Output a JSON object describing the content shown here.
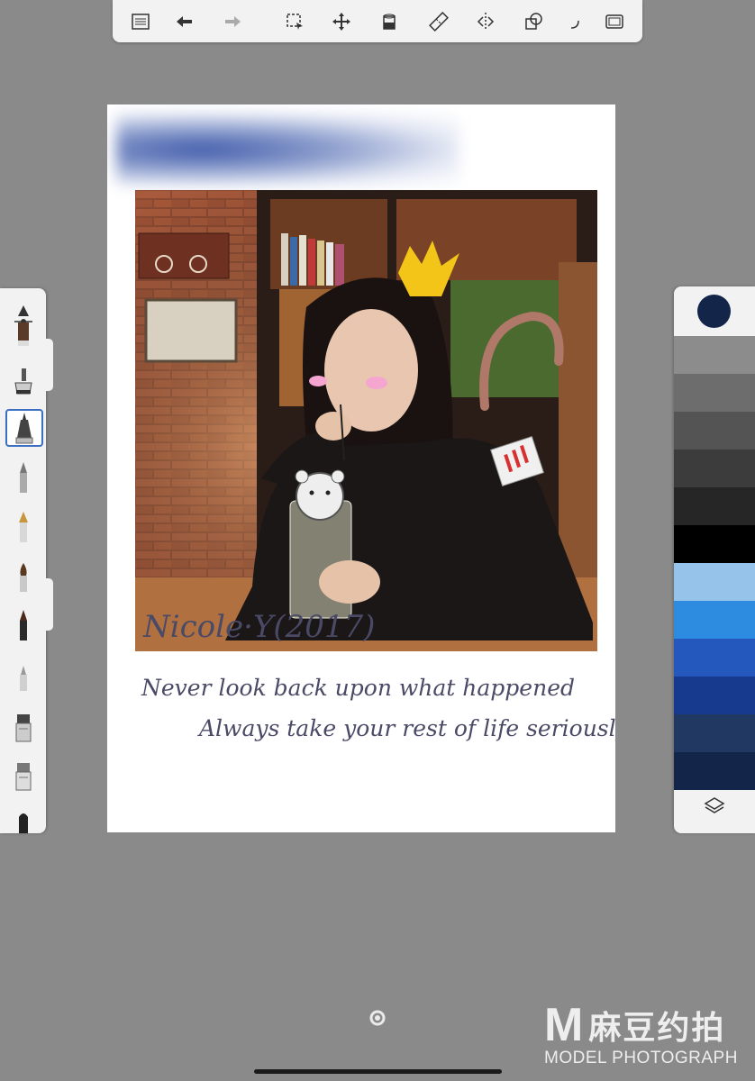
{
  "toolbar": {
    "buttons": [
      {
        "name": "menu-button",
        "icon": "list-icon"
      },
      {
        "name": "undo-button",
        "icon": "undo-arrow-icon"
      },
      {
        "name": "redo-button",
        "icon": "redo-arrow-icon"
      },
      {
        "name": "selection-button",
        "icon": "selection-icon"
      },
      {
        "name": "transform-button",
        "icon": "move-arrows-icon"
      },
      {
        "name": "fill-button",
        "icon": "paint-bucket-icon"
      },
      {
        "name": "ruler-button",
        "icon": "ruler-icon"
      },
      {
        "name": "symmetry-button",
        "icon": "symmetry-icon"
      },
      {
        "name": "shapes-button",
        "icon": "shapes-icon"
      },
      {
        "name": "curve-button",
        "icon": "curve-icon"
      },
      {
        "name": "fullscreen-button",
        "icon": "fullscreen-icon"
      }
    ]
  },
  "brushes": [
    {
      "name": "brush-size-slider",
      "icon": "triangle-slider-icon"
    },
    {
      "name": "brush-marker-top",
      "icon": "marker-icon"
    },
    {
      "name": "brush-inkpot",
      "icon": "ink-pot-icon"
    },
    {
      "name": "brush-fineliner",
      "icon": "fineliner-icon",
      "selected": true
    },
    {
      "name": "brush-pencil",
      "icon": "pencil-icon"
    },
    {
      "name": "brush-fountain-pen",
      "icon": "fountain-pen-icon"
    },
    {
      "name": "brush-paintbrush",
      "icon": "paintbrush-icon"
    },
    {
      "name": "brush-round",
      "icon": "round-brush-icon"
    },
    {
      "name": "brush-airbrush",
      "icon": "airbrush-icon"
    },
    {
      "name": "brush-marker-a",
      "icon": "marker-icon"
    },
    {
      "name": "brush-marker-b",
      "icon": "marker-icon"
    },
    {
      "name": "brush-chisel",
      "icon": "chisel-icon"
    }
  ],
  "colors": {
    "current": "#14254a",
    "swatches": [
      "#8c8c8c",
      "#6d6d6d",
      "#545454",
      "#3c3c3c",
      "#262626",
      "#000000",
      "#95c3ea",
      "#2e8ce0",
      "#2458bd",
      "#173a8e",
      "#213863",
      "#14254a"
    ]
  },
  "canvas": {
    "signature": "Nicole·Y(2017)",
    "line1": "Never look back upon what happened",
    "line2": "Always take your rest of life seriously"
  },
  "watermark": {
    "logo": "M",
    "chinese": "麻豆约拍",
    "english": "MODEL PHOTOGRAPH"
  }
}
